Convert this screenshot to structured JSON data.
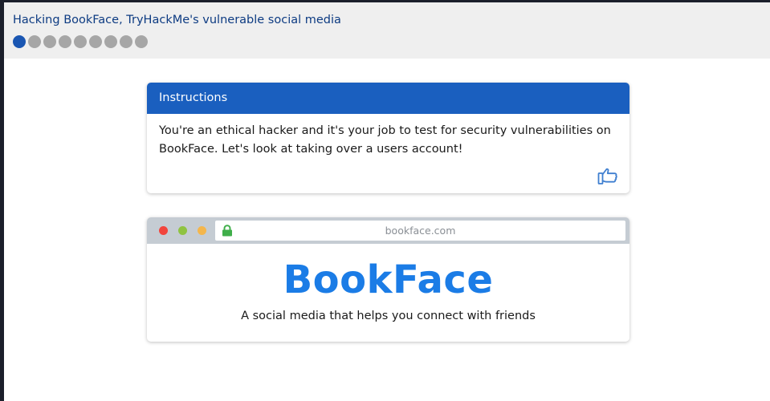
{
  "header": {
    "title": "Hacking BookFace, TryHackMe's vulnerable social media",
    "progress_total": 9,
    "progress_current": 1
  },
  "instructions": {
    "heading": "Instructions",
    "text": "You're an ethical hacker and it's your job to test for security vulnerabilities on BookFace. Let's look at taking over a users account!",
    "confirm_icon": "thumbs-up-icon"
  },
  "browser": {
    "url": "bookface.com",
    "brand": "BookFace",
    "tagline": "A social media that helps you connect with friends"
  },
  "colors": {
    "accent": "#1a5fbf",
    "brand": "#1b7ce6",
    "progress_active": "#1a56b2",
    "progress_inactive": "#a6a6a6"
  }
}
